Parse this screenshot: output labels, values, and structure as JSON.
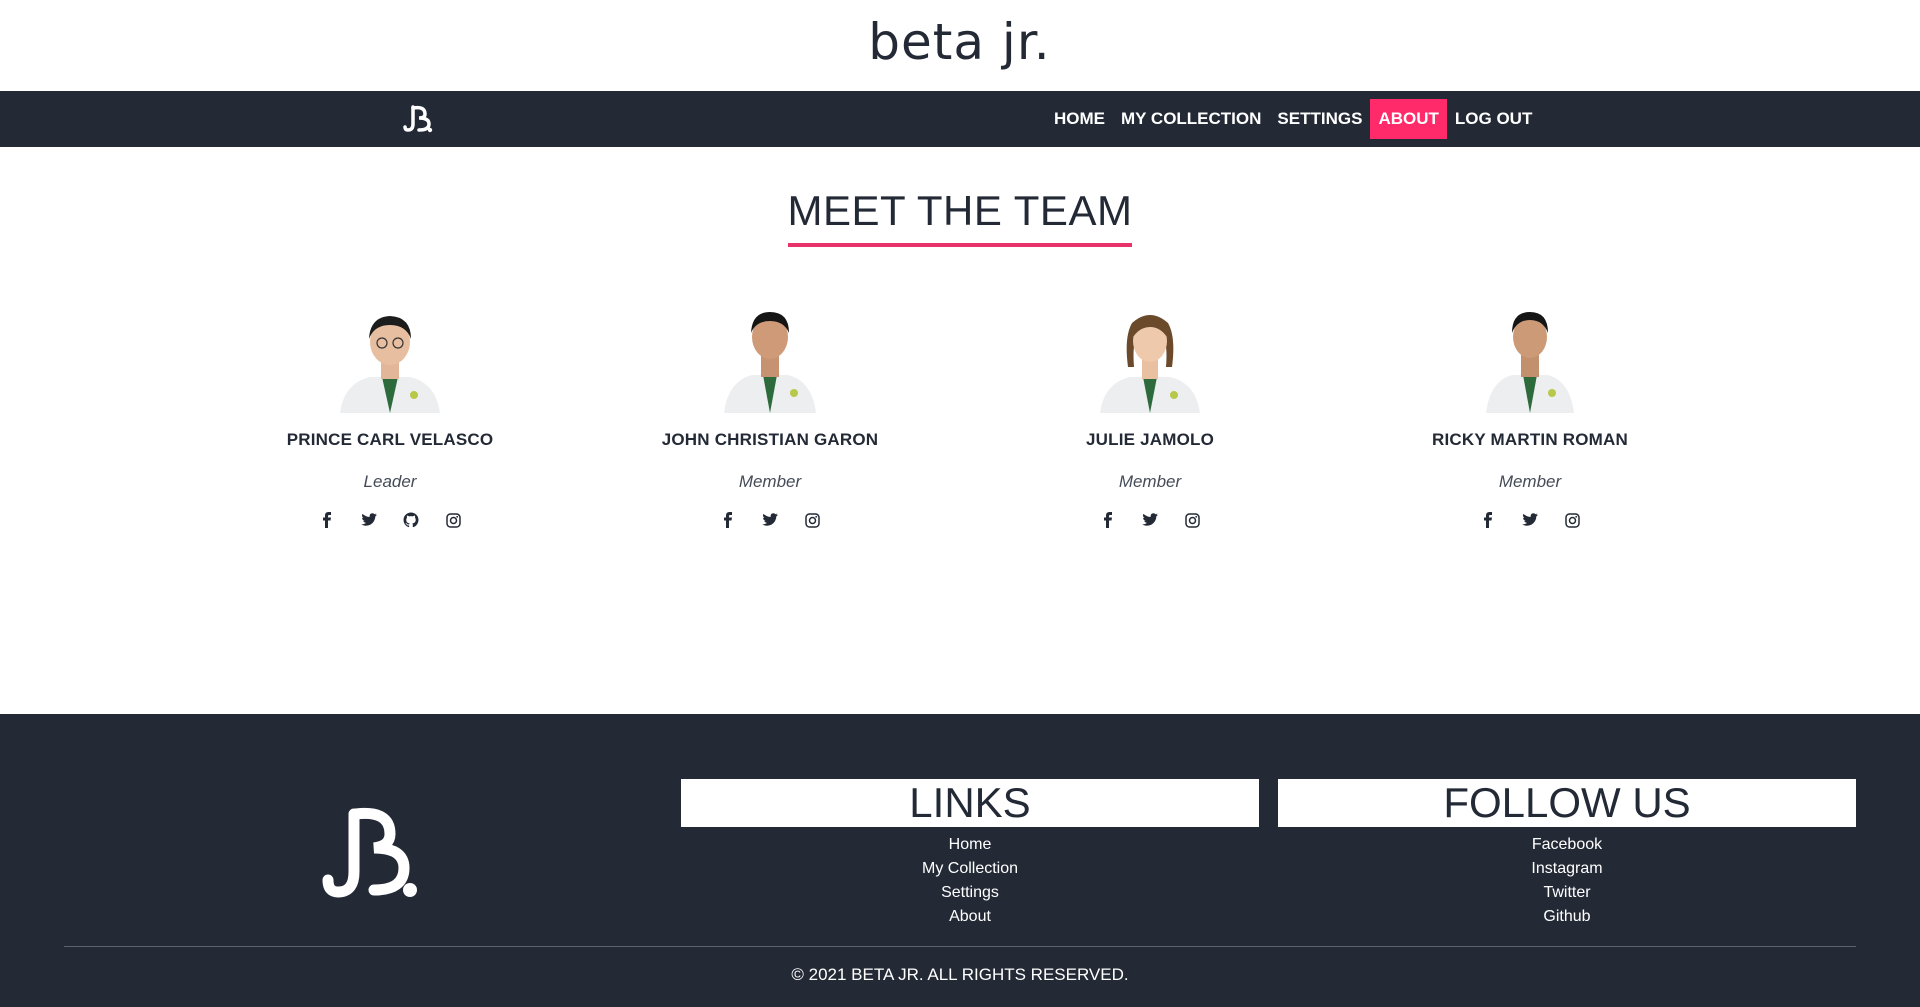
{
  "brand": {
    "title": "beta jr."
  },
  "nav": {
    "items": [
      {
        "label": "HOME"
      },
      {
        "label": "MY COLLECTION"
      },
      {
        "label": "SETTINGS"
      },
      {
        "label": "ABOUT",
        "active": true
      },
      {
        "label": "LOG OUT"
      }
    ]
  },
  "main": {
    "title": "MEET THE TEAM",
    "members": [
      {
        "name": "PRINCE CARL VELASCO",
        "role": "Leader",
        "socials": [
          "facebook-icon",
          "twitter-icon",
          "github-icon",
          "instagram-icon"
        ]
      },
      {
        "name": "JOHN CHRISTIAN GARON",
        "role": "Member",
        "socials": [
          "facebook-icon",
          "twitter-icon",
          "instagram-icon"
        ]
      },
      {
        "name": "JULIE JAMOLO",
        "role": "Member",
        "socials": [
          "facebook-icon",
          "twitter-icon",
          "instagram-icon"
        ]
      },
      {
        "name": "RICKY MARTIN ROMAN",
        "role": "Member",
        "socials": [
          "facebook-icon",
          "twitter-icon",
          "instagram-icon"
        ]
      }
    ]
  },
  "footer": {
    "links": {
      "heading": "LINKS",
      "items": [
        "Home",
        "My Collection",
        "Settings",
        "About"
      ]
    },
    "follow": {
      "heading": "FOLLOW US",
      "items": [
        "Facebook",
        "Instagram",
        "Twitter",
        "Github"
      ]
    },
    "copyright": "© 2021 BETA JR. ALL RIGHTS RESERVED."
  },
  "colors": {
    "dark": "#232a36",
    "accent": "#ff2a6a",
    "underline": "#e8336a"
  }
}
